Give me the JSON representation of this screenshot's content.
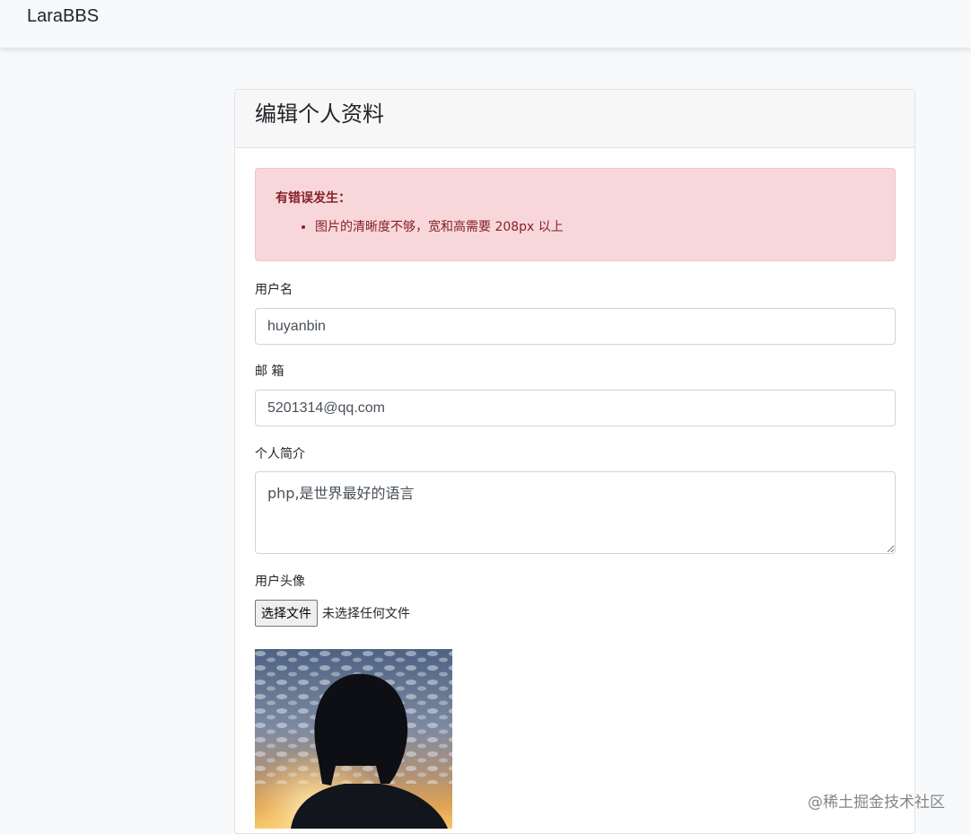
{
  "navbar": {
    "brand": "LaraBBS"
  },
  "card": {
    "title": "编辑个人资料"
  },
  "alert": {
    "title": "有错误发生：",
    "errors": [
      "图片的清晰度不够，宽和高需要 208px 以上"
    ]
  },
  "form": {
    "username_label": "用户名",
    "username_value": "huyanbin",
    "email_label": "邮 箱",
    "email_value": "5201314@qq.com",
    "intro_label": "个人简介",
    "intro_value": "php,是世界最好的语言",
    "avatar_label": "用户头像",
    "file_button": "选择文件",
    "file_status": "未选择任何文件"
  },
  "watermark": "@稀土掘金技术社区",
  "colors": {
    "alert_bg": "#f8d7da",
    "alert_text": "#842029",
    "navbar_bg": "#f8f9fa"
  }
}
